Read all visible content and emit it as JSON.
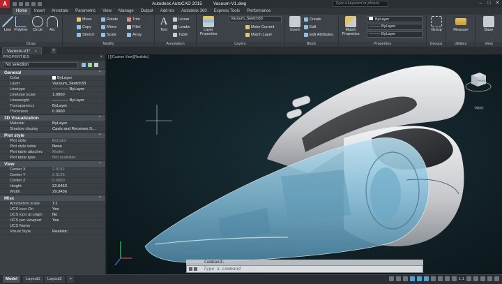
{
  "window": {
    "app_title": "Autodesk AutoCAD 2015",
    "file_title": "Vacuum-V1.dwg",
    "search_placeholder": "Type a keyword or phrase"
  },
  "ribbon_tabs": [
    "Home",
    "Insert",
    "Annotate",
    "Parametric",
    "View",
    "Manage",
    "Output",
    "Add-ins",
    "Autodesk 360",
    "Express Tools",
    "Performance"
  ],
  "ribbon": {
    "draw": {
      "title": "Draw",
      "line": "Line",
      "polyline": "Polyline",
      "circle": "Circle",
      "arc": "Arc"
    },
    "modify": {
      "title": "Modify",
      "move": "Move",
      "rotate": "Rotate",
      "trim": "Trim",
      "copy": "Copy",
      "mirror": "Mirror",
      "fillet": "Fillet",
      "stretch": "Stretch",
      "scale": "Scale",
      "array": "Array"
    },
    "annotation": {
      "title": "Annotation",
      "text": "Text",
      "linear": "Linear",
      "leader": "Leader",
      "table": "Table"
    },
    "layers": {
      "title": "Layers",
      "layer_properties_1": "Layer",
      "layer_properties_2": "Properties",
      "current_layer": "Vacuum_Sketch33",
      "make_current": "Make Current",
      "match_layer": "Match Layer"
    },
    "block": {
      "title": "Block",
      "insert": "Insert",
      "create": "Create",
      "edit": "Edit",
      "edit_attributes": "Edit Attributes"
    },
    "properties": {
      "title": "Properties",
      "match_1": "Match",
      "match_2": "Properties",
      "color": "ByLayer",
      "linetype": "ByLayer",
      "lineweight": "ByLayer"
    },
    "groups": {
      "title": "Groups",
      "group": "Group"
    },
    "utilities": {
      "title": "Utilities",
      "measure": "Measure"
    },
    "view": {
      "title": "View",
      "base": "Base"
    }
  },
  "file_tab": {
    "label": "Vacuum-V1*"
  },
  "properties_palette": {
    "title": "PROPERTIES",
    "selection": "No selection",
    "sections": [
      {
        "name": "General",
        "rows": [
          {
            "key": "Color",
            "value": "ByLayer",
            "swatch": "#ffffff"
          },
          {
            "key": "Layer",
            "value": "Vacuum_Sketch33"
          },
          {
            "key": "Linetype",
            "value": "———— ByLayer"
          },
          {
            "key": "Linetype scale",
            "value": "1.0000"
          },
          {
            "key": "Lineweight",
            "value": "———— ByLayer"
          },
          {
            "key": "Transparency",
            "value": "ByLayer"
          },
          {
            "key": "Thickness",
            "value": "0.0000"
          }
        ]
      },
      {
        "name": "3D Visualization",
        "rows": [
          {
            "key": "Material",
            "value": "ByLayer"
          },
          {
            "key": "Shadow display",
            "value": "Casts and Receives S..."
          }
        ]
      },
      {
        "name": "Plot style",
        "rows": [
          {
            "key": "Plot style",
            "value": "ByColor",
            "dim": true
          },
          {
            "key": "Plot style table",
            "value": "None"
          },
          {
            "key": "Plot table attached to",
            "value": "Model",
            "dim": true
          },
          {
            "key": "Plot table type",
            "value": "Not available",
            "dim": true
          }
        ]
      },
      {
        "name": "View",
        "rows": [
          {
            "key": "Center X",
            "value": "2.9192",
            "dim": true
          },
          {
            "key": "Center Y",
            "value": "2.3136",
            "dim": true
          },
          {
            "key": "Center Z",
            "value": "0.0000",
            "dim": true
          },
          {
            "key": "Height",
            "value": "22.6463"
          },
          {
            "key": "Width",
            "value": "29.3436"
          }
        ]
      },
      {
        "name": "Misc",
        "rows": [
          {
            "key": "Annotation scale",
            "value": "1:1"
          },
          {
            "key": "UCS icon On",
            "value": "Yes"
          },
          {
            "key": "UCS icon at origin",
            "value": "No"
          },
          {
            "key": "UCS per viewport",
            "value": "Yes"
          },
          {
            "key": "UCS Name",
            "value": ""
          },
          {
            "key": "Visual Style",
            "value": "Realistic"
          }
        ]
      }
    ]
  },
  "viewport": {
    "label": "[-][Custom View][Realistic]",
    "viewcube_face": "FRONT",
    "viewcube_wcs": "WCS"
  },
  "command_line": {
    "history": "Command:",
    "placeholder": "Type a command"
  },
  "status_bar": {
    "layout_tabs": [
      "Model",
      "Layout1",
      "Layout2"
    ],
    "scale": "1:1"
  },
  "colors": {
    "accent_red": "#b8262b",
    "viewport_bg": "#0f1f24",
    "shell_blue": "#8fc3dc",
    "handle_gray": "#c8c9cb"
  }
}
